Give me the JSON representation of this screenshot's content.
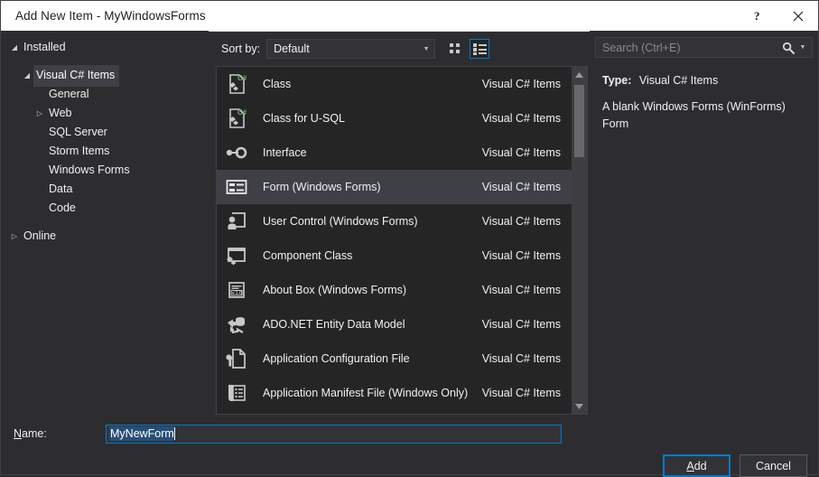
{
  "window": {
    "title": "Add New Item - MyWindowsForms",
    "help_label": "?",
    "close_label": "×"
  },
  "sidebar": {
    "nodes": [
      {
        "label": "Installed",
        "level": 0,
        "arrow": "◢",
        "selected": false
      },
      {
        "label": "Visual C# Items",
        "level": 1,
        "arrow": "◢",
        "selected": true
      },
      {
        "label": "General",
        "level": 2,
        "arrow": "",
        "selected": false
      },
      {
        "label": "Web",
        "level": 2,
        "arrow": "▷",
        "selected": false
      },
      {
        "label": "SQL Server",
        "level": 2,
        "arrow": "",
        "selected": false
      },
      {
        "label": "Storm Items",
        "level": 2,
        "arrow": "",
        "selected": false
      },
      {
        "label": "Windows Forms",
        "level": 2,
        "arrow": "",
        "selected": false
      },
      {
        "label": "Data",
        "level": 2,
        "arrow": "",
        "selected": false
      },
      {
        "label": "Code",
        "level": 2,
        "arrow": "",
        "selected": false
      },
      {
        "label": "Online",
        "level": 0,
        "arrow": "▷",
        "selected": false
      }
    ]
  },
  "toolbar": {
    "sort_label": "Sort by:",
    "sort_value": "Default",
    "sort_arrow": "▼",
    "view_grid": "grid-view",
    "view_list": "list-view",
    "active_view": "list-view"
  },
  "search": {
    "placeholder": "Search (Ctrl+E)",
    "icon": "search-icon",
    "dropdown_arrow": "▼"
  },
  "items": [
    {
      "name": "Class",
      "category": "Visual C# Items",
      "icon": "class-icon",
      "selected": false
    },
    {
      "name": "Class for U-SQL",
      "category": "Visual C# Items",
      "icon": "class-icon",
      "selected": false
    },
    {
      "name": "Interface",
      "category": "Visual C# Items",
      "icon": "interface-icon",
      "selected": false
    },
    {
      "name": "Form (Windows Forms)",
      "category": "Visual C# Items",
      "icon": "form-icon",
      "selected": true
    },
    {
      "name": "User Control (Windows Forms)",
      "category": "Visual C# Items",
      "icon": "user-control-icon",
      "selected": false
    },
    {
      "name": "Component Class",
      "category": "Visual C# Items",
      "icon": "component-class-icon",
      "selected": false
    },
    {
      "name": "About Box (Windows Forms)",
      "category": "Visual C# Items",
      "icon": "about-box-icon",
      "selected": false
    },
    {
      "name": "ADO.NET Entity Data Model",
      "category": "Visual C# Items",
      "icon": "ado-net-icon",
      "selected": false
    },
    {
      "name": "Application Configuration File",
      "category": "Visual C# Items",
      "icon": "app-config-icon",
      "selected": false
    },
    {
      "name": "Application Manifest File (Windows Only)",
      "category": "Visual C# Items",
      "icon": "app-manifest-icon",
      "selected": false
    },
    {
      "name": "",
      "category": "",
      "icon": "bitmap-file-icon",
      "selected": false
    }
  ],
  "details": {
    "type_label": "Type:",
    "type_value": "Visual C# Items",
    "description": "A blank Windows Forms (WinForms) Form"
  },
  "footer": {
    "name_label_prefix": "N",
    "name_label_rest": "ame:",
    "name_value": "MyNewForm",
    "add_label_prefix": "A",
    "add_label_rest": "dd",
    "cancel_label": "Cancel"
  },
  "colors": {
    "accent": "#007acc",
    "selection": "#264f78",
    "row_selected": "#3f3f46",
    "csharp_green": "#68b568"
  }
}
